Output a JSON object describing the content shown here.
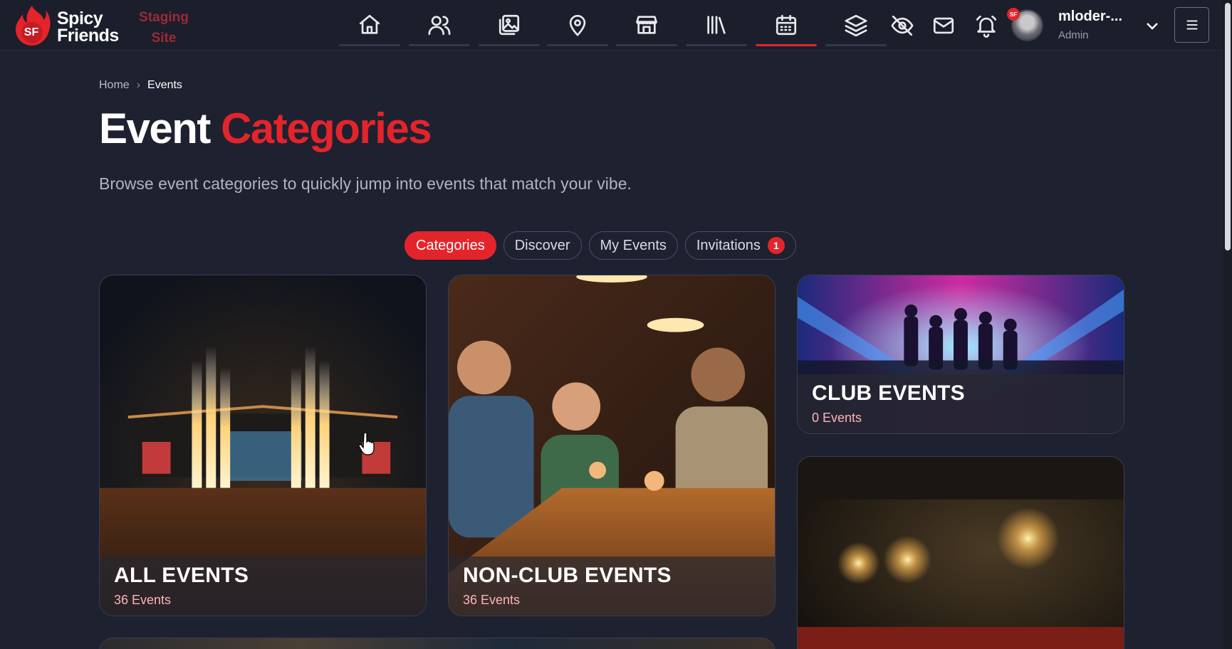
{
  "brand": {
    "name_line1": "Spicy",
    "name_line2": "Friends",
    "env_line1": "Staging",
    "env_line2": "Site",
    "logo_initials": "SF"
  },
  "nav": {
    "items": [
      {
        "icon": "home-icon",
        "active": false
      },
      {
        "icon": "users-icon",
        "active": false
      },
      {
        "icon": "gallery-icon",
        "active": false
      },
      {
        "icon": "location-pin-icon",
        "active": false
      },
      {
        "icon": "store-icon",
        "active": false
      },
      {
        "icon": "library-icon",
        "active": false
      },
      {
        "icon": "calendar-icon",
        "active": true
      },
      {
        "icon": "layers-icon",
        "active": false
      }
    ],
    "tools": [
      "eye-off-icon",
      "mail-icon",
      "bell-icon"
    ]
  },
  "user": {
    "name": "mloder-...",
    "role": "Admin",
    "badge": "SF"
  },
  "breadcrumb": {
    "home": "Home",
    "separator": "›",
    "current": "Events"
  },
  "page": {
    "title_main": "Event",
    "title_accent": "Categories",
    "subtitle": "Browse event categories to quickly jump into events that match your vibe."
  },
  "tabs": [
    {
      "label": "Categories",
      "active": true
    },
    {
      "label": "Discover",
      "active": false
    },
    {
      "label": "My Events",
      "active": false
    },
    {
      "label": "Invitations",
      "active": false,
      "count": "1"
    }
  ],
  "cards": [
    {
      "name": "ALL EVENTS",
      "count": "36 Events"
    },
    {
      "name": "NON-CLUB EVENTS",
      "count": "36 Events"
    },
    {
      "name": "CLUB EVENTS",
      "count": "0 Events"
    }
  ],
  "colors": {
    "accent": "#e3242b",
    "background": "#1e2130",
    "topbar": "#1b1e2b"
  }
}
